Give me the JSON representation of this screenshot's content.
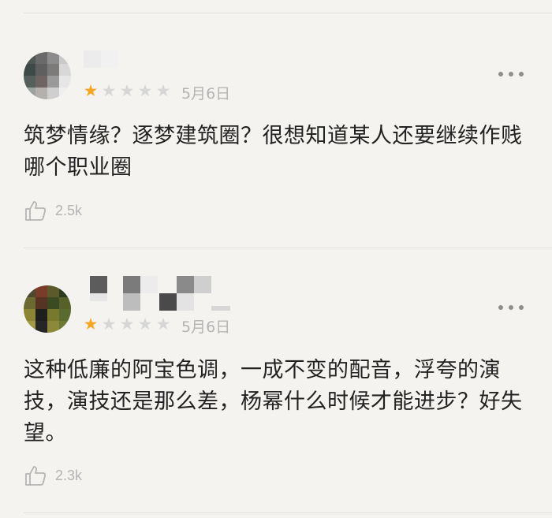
{
  "reviews": [
    {
      "rating": 1,
      "max_rating": 5,
      "date": "5月6日",
      "content": "筑梦情缘？逐梦建筑圈？很想知道某人还要继续作贱哪个职业圈",
      "likes": "2.5k"
    },
    {
      "rating": 1,
      "max_rating": 5,
      "date": "5月6日",
      "content": "这种低廉的阿宝色调，一成不变的配音，浮夸的演技，演技还是那么差，杨幂什么时候才能进步？好失望。",
      "likes": "2.3k"
    }
  ],
  "colors": {
    "background": "#f4f3f0",
    "star_active": "#f5a623",
    "star_inactive": "#d6d6d6",
    "meta_text": "#b4b4b4",
    "body_text": "#222222"
  },
  "icons": {
    "more": "more-dots-icon",
    "like": "thumbs-up-icon",
    "star": "star-icon"
  }
}
